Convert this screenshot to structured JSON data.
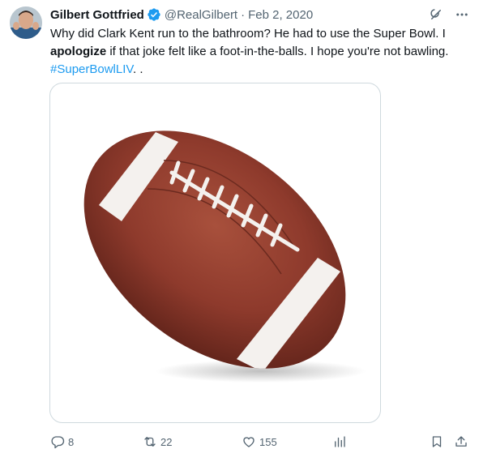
{
  "tweet": {
    "author_name": "Gilbert Gottfried",
    "handle": "@RealGilbert",
    "separator": "·",
    "date": "Feb 2, 2020",
    "text_part1": "Why did Clark Kent run to the bathroom?  He had to use the Super Bowl.  I ",
    "text_bold": "apologize",
    "text_part2": " if that joke felt like a foot-in-the-balls.  I hope you're not bawling. ",
    "hashtag": "#SuperBowlLIV",
    "text_end": ".  ."
  },
  "media": {
    "subject_icon": "american-football-photo"
  },
  "actions": {
    "replies": "8",
    "retweets": "22",
    "likes": "155",
    "views": ""
  },
  "colors": {
    "accent": "#1d9bf0",
    "secondary_text": "#536471",
    "border": "#cfd9de",
    "football": "#8e3a2c"
  },
  "icons": [
    "avatar",
    "verified-badge-icon",
    "grok-icon",
    "more-icon",
    "reply-icon",
    "retweet-icon",
    "like-icon",
    "views-icon",
    "bookmark-icon",
    "share-icon"
  ]
}
